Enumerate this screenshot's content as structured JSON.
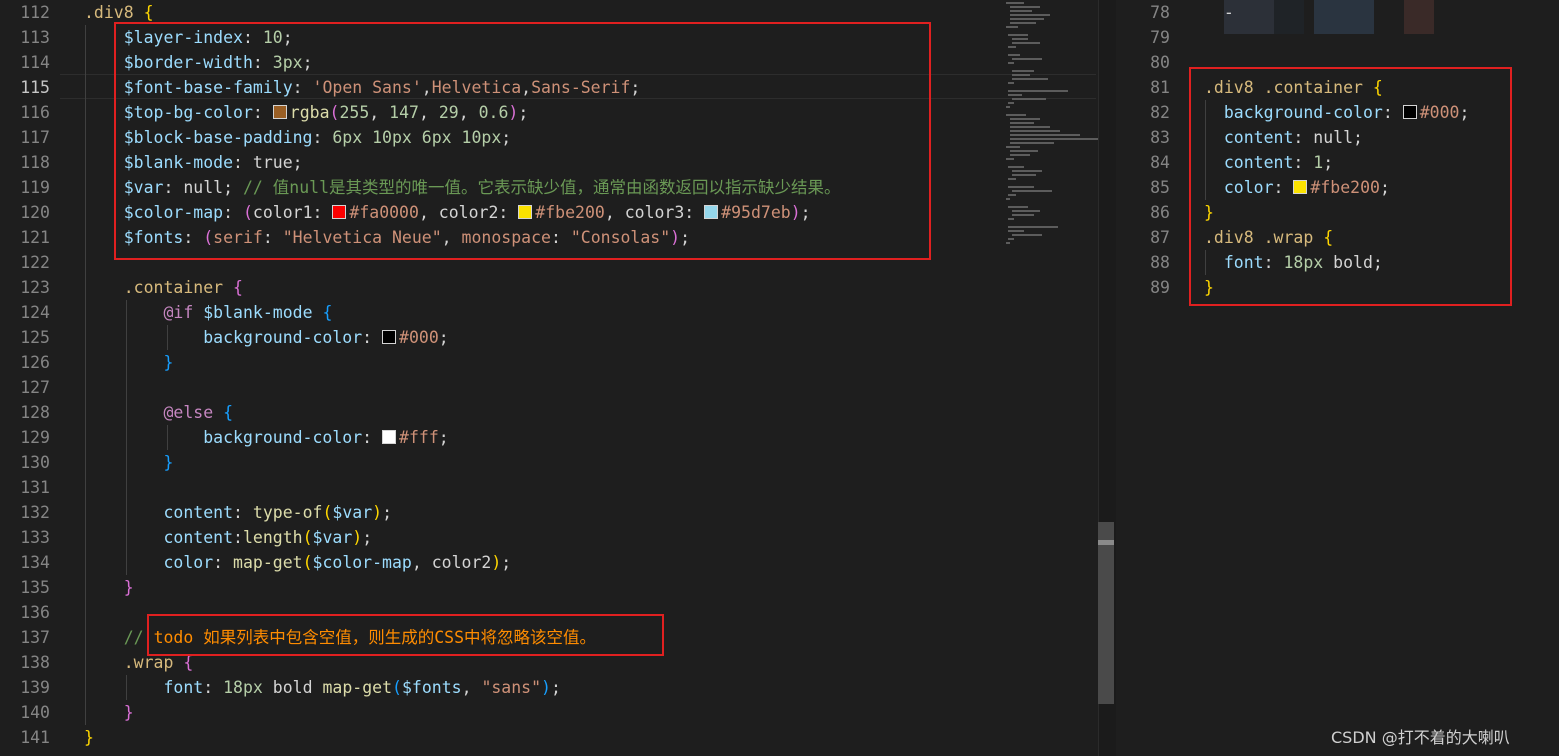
{
  "left_editor": {
    "lines": [
      {
        "n": "112",
        "segs": [
          {
            "t": ".div8",
            "c": "sel"
          },
          {
            "t": " ",
            "c": "pl"
          },
          {
            "t": "{",
            "c": "br1"
          }
        ]
      },
      {
        "n": "113",
        "segs": [
          {
            "t": "    ",
            "c": "pl"
          },
          {
            "t": "$layer-index",
            "c": "var"
          },
          {
            "t": ": ",
            "c": "pl"
          },
          {
            "t": "10",
            "c": "num"
          },
          {
            "t": ";",
            "c": "pl"
          }
        ]
      },
      {
        "n": "114",
        "segs": [
          {
            "t": "    ",
            "c": "pl"
          },
          {
            "t": "$border-width",
            "c": "var"
          },
          {
            "t": ": ",
            "c": "pl"
          },
          {
            "t": "3px",
            "c": "num"
          },
          {
            "t": ";",
            "c": "pl"
          }
        ]
      },
      {
        "n": "115",
        "active": true,
        "segs": [
          {
            "t": "    ",
            "c": "pl"
          },
          {
            "t": "$font-base-family",
            "c": "var"
          },
          {
            "t": ": ",
            "c": "pl"
          },
          {
            "t": "'Open Sans'",
            "c": "str"
          },
          {
            "t": ",",
            "c": "pl"
          },
          {
            "t": "Helvetica",
            "c": "str"
          },
          {
            "t": ",",
            "c": "pl"
          },
          {
            "t": "Sans-Serif",
            "c": "str"
          },
          {
            "t": ";",
            "c": "pl"
          }
        ]
      },
      {
        "n": "116",
        "segs": [
          {
            "t": "    ",
            "c": "pl"
          },
          {
            "t": "$top-bg-color",
            "c": "var"
          },
          {
            "t": ": ",
            "c": "pl"
          },
          {
            "sw": "#9a5f25"
          },
          {
            "t": "rgba",
            "c": "fn"
          },
          {
            "t": "(",
            "c": "br2"
          },
          {
            "t": "255",
            "c": "num"
          },
          {
            "t": ", ",
            "c": "pl"
          },
          {
            "t": "147",
            "c": "num"
          },
          {
            "t": ", ",
            "c": "pl"
          },
          {
            "t": "29",
            "c": "num"
          },
          {
            "t": ", ",
            "c": "pl"
          },
          {
            "t": "0.6",
            "c": "num"
          },
          {
            "t": ")",
            "c": "br2"
          },
          {
            "t": ";",
            "c": "pl"
          }
        ]
      },
      {
        "n": "117",
        "segs": [
          {
            "t": "    ",
            "c": "pl"
          },
          {
            "t": "$block-base-padding",
            "c": "var"
          },
          {
            "t": ": ",
            "c": "pl"
          },
          {
            "t": "6px 10px 6px 10px",
            "c": "num"
          },
          {
            "t": ";",
            "c": "pl"
          }
        ]
      },
      {
        "n": "118",
        "segs": [
          {
            "t": "    ",
            "c": "pl"
          },
          {
            "t": "$blank-mode",
            "c": "var"
          },
          {
            "t": ": ",
            "c": "pl"
          },
          {
            "t": "true",
            "c": "pl"
          },
          {
            "t": ";",
            "c": "pl"
          }
        ]
      },
      {
        "n": "119",
        "segs": [
          {
            "t": "    ",
            "c": "pl"
          },
          {
            "t": "$var",
            "c": "var"
          },
          {
            "t": ": ",
            "c": "pl"
          },
          {
            "t": "null",
            "c": "pl"
          },
          {
            "t": "; ",
            "c": "pl"
          },
          {
            "t": "// 值null是其类型的唯一值。它表示缺少值，通常由函数返回以指示缺少结果。",
            "c": "cmt"
          }
        ]
      },
      {
        "n": "120",
        "segs": [
          {
            "t": "    ",
            "c": "pl"
          },
          {
            "t": "$color-map",
            "c": "var"
          },
          {
            "t": ": ",
            "c": "pl"
          },
          {
            "t": "(",
            "c": "br2"
          },
          {
            "t": "color1: ",
            "c": "pl"
          },
          {
            "sw": "#fa0000"
          },
          {
            "t": "#fa0000",
            "c": "str"
          },
          {
            "t": ", color2: ",
            "c": "pl"
          },
          {
            "sw": "#fbe200"
          },
          {
            "t": "#fbe200",
            "c": "str"
          },
          {
            "t": ", color3: ",
            "c": "pl"
          },
          {
            "sw": "#95d7eb"
          },
          {
            "t": "#95d7eb",
            "c": "str"
          },
          {
            "t": ")",
            "c": "br2"
          },
          {
            "t": ";",
            "c": "pl"
          }
        ]
      },
      {
        "n": "121",
        "segs": [
          {
            "t": "    ",
            "c": "pl"
          },
          {
            "t": "$fonts",
            "c": "var"
          },
          {
            "t": ": ",
            "c": "pl"
          },
          {
            "t": "(",
            "c": "br2"
          },
          {
            "t": "serif",
            "c": "str"
          },
          {
            "t": ": ",
            "c": "pl"
          },
          {
            "t": "\"Helvetica Neue\"",
            "c": "str"
          },
          {
            "t": ", ",
            "c": "pl"
          },
          {
            "t": "monospace",
            "c": "str"
          },
          {
            "t": ": ",
            "c": "pl"
          },
          {
            "t": "\"Consolas\"",
            "c": "str"
          },
          {
            "t": ")",
            "c": "br2"
          },
          {
            "t": ";",
            "c": "pl"
          }
        ]
      },
      {
        "n": "122",
        "segs": []
      },
      {
        "n": "123",
        "segs": [
          {
            "t": "    ",
            "c": "pl"
          },
          {
            "t": ".container",
            "c": "sel"
          },
          {
            "t": " ",
            "c": "pl"
          },
          {
            "t": "{",
            "c": "br2"
          }
        ]
      },
      {
        "n": "124",
        "segs": [
          {
            "t": "        ",
            "c": "pl"
          },
          {
            "t": "@if",
            "c": "kw"
          },
          {
            "t": " ",
            "c": "pl"
          },
          {
            "t": "$blank-mode",
            "c": "var"
          },
          {
            "t": " ",
            "c": "pl"
          },
          {
            "t": "{",
            "c": "br3"
          }
        ]
      },
      {
        "n": "125",
        "segs": [
          {
            "t": "            ",
            "c": "pl"
          },
          {
            "t": "background-color",
            "c": "var"
          },
          {
            "t": ": ",
            "c": "pl"
          },
          {
            "sw": "#000000"
          },
          {
            "t": "#000",
            "c": "str"
          },
          {
            "t": ";",
            "c": "pl"
          }
        ]
      },
      {
        "n": "126",
        "segs": [
          {
            "t": "        ",
            "c": "pl"
          },
          {
            "t": "}",
            "c": "br3"
          }
        ]
      },
      {
        "n": "127",
        "segs": []
      },
      {
        "n": "128",
        "segs": [
          {
            "t": "        ",
            "c": "pl"
          },
          {
            "t": "@else",
            "c": "kw"
          },
          {
            "t": " ",
            "c": "pl"
          },
          {
            "t": "{",
            "c": "br3"
          }
        ]
      },
      {
        "n": "129",
        "segs": [
          {
            "t": "            ",
            "c": "pl"
          },
          {
            "t": "background-color",
            "c": "var"
          },
          {
            "t": ": ",
            "c": "pl"
          },
          {
            "sw": "#ffffff"
          },
          {
            "t": "#fff",
            "c": "str"
          },
          {
            "t": ";",
            "c": "pl"
          }
        ]
      },
      {
        "n": "130",
        "segs": [
          {
            "t": "        ",
            "c": "pl"
          },
          {
            "t": "}",
            "c": "br3"
          }
        ]
      },
      {
        "n": "131",
        "segs": []
      },
      {
        "n": "132",
        "segs": [
          {
            "t": "        ",
            "c": "pl"
          },
          {
            "t": "content",
            "c": "var"
          },
          {
            "t": ": ",
            "c": "pl"
          },
          {
            "t": "type-of",
            "c": "fn"
          },
          {
            "t": "(",
            "c": "br1"
          },
          {
            "t": "$var",
            "c": "var"
          },
          {
            "t": ")",
            "c": "br1"
          },
          {
            "t": ";",
            "c": "pl"
          }
        ]
      },
      {
        "n": "133",
        "segs": [
          {
            "t": "        ",
            "c": "pl"
          },
          {
            "t": "content",
            "c": "var"
          },
          {
            "t": ":",
            "c": "pl"
          },
          {
            "t": "length",
            "c": "fn"
          },
          {
            "t": "(",
            "c": "br1"
          },
          {
            "t": "$var",
            "c": "var"
          },
          {
            "t": ")",
            "c": "br1"
          },
          {
            "t": ";",
            "c": "pl"
          }
        ]
      },
      {
        "n": "134",
        "segs": [
          {
            "t": "        ",
            "c": "pl"
          },
          {
            "t": "color",
            "c": "var"
          },
          {
            "t": ": ",
            "c": "pl"
          },
          {
            "t": "map-get",
            "c": "fn"
          },
          {
            "t": "(",
            "c": "br1"
          },
          {
            "t": "$color-map",
            "c": "var"
          },
          {
            "t": ", ",
            "c": "pl"
          },
          {
            "t": "color2",
            "c": "pl"
          },
          {
            "t": ")",
            "c": "br1"
          },
          {
            "t": ";",
            "c": "pl"
          }
        ]
      },
      {
        "n": "135",
        "segs": [
          {
            "t": "    ",
            "c": "pl"
          },
          {
            "t": "}",
            "c": "br2"
          }
        ]
      },
      {
        "n": "136",
        "segs": []
      },
      {
        "n": "137",
        "segs": [
          {
            "t": "    ",
            "c": "pl"
          },
          {
            "t": "// ",
            "c": "cmt"
          },
          {
            "t": "todo 如果列表中包含空值，则生成的CSS中将忽略该空值。",
            "c": "todo"
          }
        ]
      },
      {
        "n": "138",
        "segs": [
          {
            "t": "    ",
            "c": "pl"
          },
          {
            "t": ".wrap",
            "c": "sel"
          },
          {
            "t": " ",
            "c": "pl"
          },
          {
            "t": "{",
            "c": "br2"
          }
        ]
      },
      {
        "n": "139",
        "segs": [
          {
            "t": "        ",
            "c": "pl"
          },
          {
            "t": "font",
            "c": "var"
          },
          {
            "t": ": ",
            "c": "pl"
          },
          {
            "t": "18px",
            "c": "num"
          },
          {
            "t": " bold ",
            "c": "pl"
          },
          {
            "t": "map-get",
            "c": "fn"
          },
          {
            "t": "(",
            "c": "br3"
          },
          {
            "t": "$fonts",
            "c": "var"
          },
          {
            "t": ", ",
            "c": "pl"
          },
          {
            "t": "\"sans\"",
            "c": "str"
          },
          {
            "t": ")",
            "c": "br3"
          },
          {
            "t": ";",
            "c": "pl"
          }
        ]
      },
      {
        "n": "140",
        "segs": [
          {
            "t": "    ",
            "c": "pl"
          },
          {
            "t": "}",
            "c": "br2"
          }
        ]
      },
      {
        "n": "141",
        "segs": [
          {
            "t": "}",
            "c": "br1"
          }
        ]
      }
    ]
  },
  "right_editor": {
    "lines": [
      {
        "n": "78",
        "segs": [
          {
            "t": "  -",
            "c": "pl"
          }
        ]
      },
      {
        "n": "79",
        "segs": []
      },
      {
        "n": "80",
        "segs": []
      },
      {
        "n": "81",
        "segs": [
          {
            "t": ".div8 .container",
            "c": "sel"
          },
          {
            "t": " ",
            "c": "pl"
          },
          {
            "t": "{",
            "c": "br1"
          }
        ]
      },
      {
        "n": "82",
        "segs": [
          {
            "t": "  ",
            "c": "pl"
          },
          {
            "t": "background-color",
            "c": "var"
          },
          {
            "t": ": ",
            "c": "pl"
          },
          {
            "sw": "#000000"
          },
          {
            "t": "#000",
            "c": "str"
          },
          {
            "t": ";",
            "c": "pl"
          }
        ]
      },
      {
        "n": "83",
        "segs": [
          {
            "t": "  ",
            "c": "pl"
          },
          {
            "t": "content",
            "c": "var"
          },
          {
            "t": ": ",
            "c": "pl"
          },
          {
            "t": "null",
            "c": "pl"
          },
          {
            "t": ";",
            "c": "pl"
          }
        ]
      },
      {
        "n": "84",
        "segs": [
          {
            "t": "  ",
            "c": "pl"
          },
          {
            "t": "content",
            "c": "var"
          },
          {
            "t": ": ",
            "c": "pl"
          },
          {
            "t": "1",
            "c": "num"
          },
          {
            "t": ";",
            "c": "pl"
          }
        ]
      },
      {
        "n": "85",
        "segs": [
          {
            "t": "  ",
            "c": "pl"
          },
          {
            "t": "color",
            "c": "var"
          },
          {
            "t": ": ",
            "c": "pl"
          },
          {
            "sw": "#fbe200"
          },
          {
            "t": "#fbe200",
            "c": "str"
          },
          {
            "t": ";",
            "c": "pl"
          }
        ]
      },
      {
        "n": "86",
        "segs": [
          {
            "t": "}",
            "c": "br1"
          }
        ]
      },
      {
        "n": "87",
        "segs": [
          {
            "t": ".div8 .wrap",
            "c": "sel"
          },
          {
            "t": " ",
            "c": "pl"
          },
          {
            "t": "{",
            "c": "br1"
          }
        ]
      },
      {
        "n": "88",
        "segs": [
          {
            "t": "  ",
            "c": "pl"
          },
          {
            "t": "font",
            "c": "var"
          },
          {
            "t": ": ",
            "c": "pl"
          },
          {
            "t": "18px",
            "c": "num"
          },
          {
            "t": " bold",
            "c": "pl"
          },
          {
            "t": ";",
            "c": "pl"
          }
        ]
      },
      {
        "n": "89",
        "segs": [
          {
            "t": "}",
            "c": "br1"
          }
        ]
      }
    ]
  },
  "watermark": "CSDN @打不着的大喇叭",
  "highlight_color": "#e02020"
}
